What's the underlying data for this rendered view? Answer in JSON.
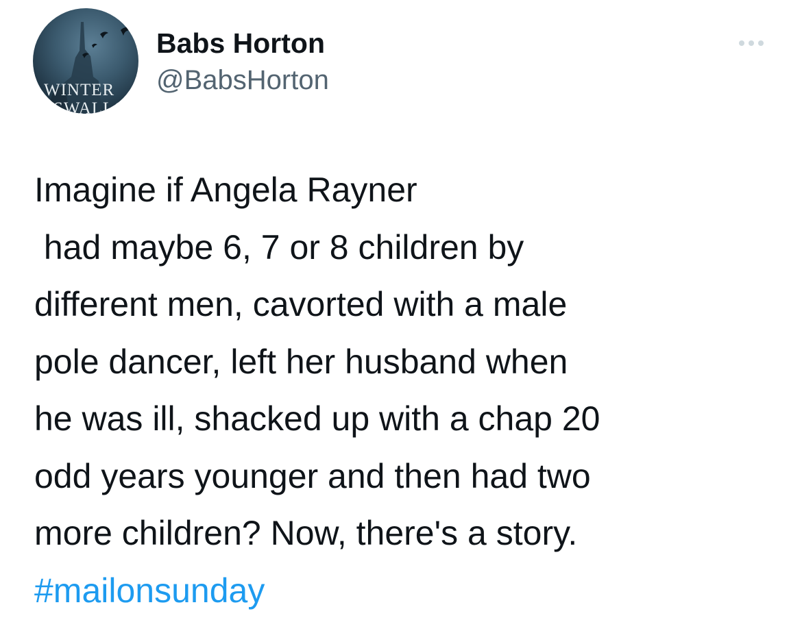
{
  "author": {
    "name": "Babs Horton",
    "handle": "@BabsHorton",
    "avatar_text_line1": "WINTER",
    "avatar_text_line2": "SWALLOWS"
  },
  "more_icon": "more-horizontal-icon",
  "tweet": {
    "lines": [
      "Imagine if Angela Rayner",
      " had maybe 6, 7 or 8 children by",
      "different men, cavorted with a male",
      "pole dancer, left her husband when",
      "he was ill, shacked up with a chap 20",
      "odd years younger and then had two",
      "more children? Now, there's a story."
    ],
    "hashtag": "#mailonsunday"
  },
  "colors": {
    "text": "#0f1419",
    "secondary": "#536471",
    "link": "#1d9bf0"
  }
}
